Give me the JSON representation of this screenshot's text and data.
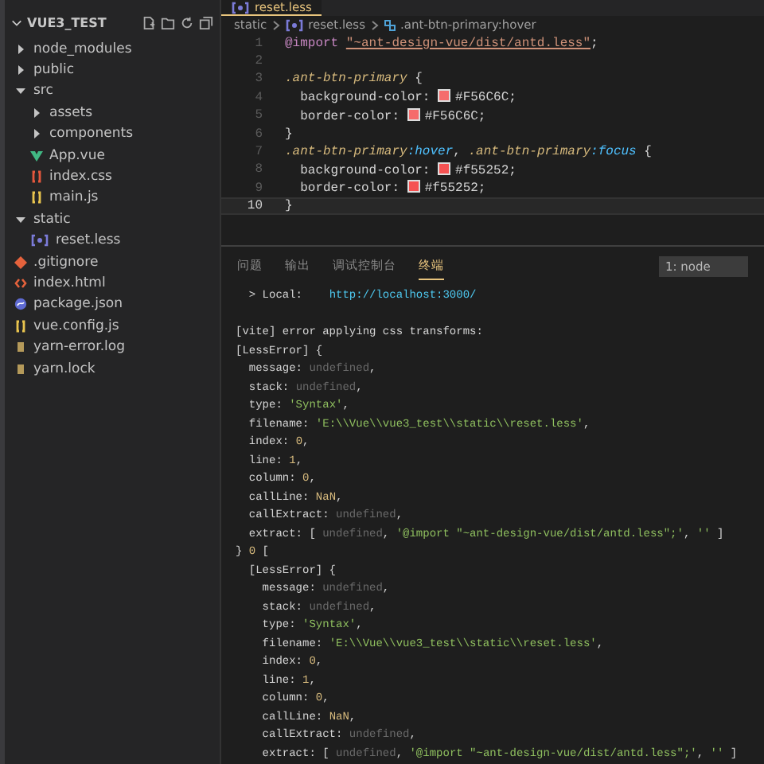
{
  "editor_tabs": [
    {
      "label": "reset.less",
      "selected": true,
      "kind": "less"
    }
  ],
  "explorer": {
    "title": "VUE3_TEST",
    "tree": [
      {
        "label": "node_modules",
        "kind": "folder",
        "expanded": false
      },
      {
        "label": "public",
        "kind": "folder",
        "expanded": false
      },
      {
        "label": "src",
        "kind": "folder",
        "expanded": true,
        "children": [
          {
            "label": "assets",
            "kind": "folder",
            "expanded": false
          },
          {
            "label": "components",
            "kind": "folder",
            "expanded": false
          },
          {
            "label": "App.vue",
            "kind": "vue"
          },
          {
            "label": "index.css",
            "kind": "css"
          },
          {
            "label": "main.js",
            "kind": "js"
          }
        ]
      },
      {
        "label": "static",
        "kind": "folder",
        "expanded": true,
        "children": [
          {
            "label": "reset.less",
            "kind": "less"
          }
        ]
      },
      {
        "label": ".gitignore",
        "kind": "git"
      },
      {
        "label": "index.html",
        "kind": "html"
      },
      {
        "label": "package.json",
        "kind": "json"
      },
      {
        "label": "vue.config.js",
        "kind": "js"
      },
      {
        "label": "yarn-error.log",
        "kind": "log"
      },
      {
        "label": "yarn.lock",
        "kind": "log"
      }
    ]
  },
  "breadcrumb": [
    {
      "label": "static",
      "kind": "plain"
    },
    {
      "label": "reset.less",
      "kind": "less"
    },
    {
      "label": ".ant-btn-primary:hover",
      "kind": "selector"
    }
  ],
  "code": [
    {
      "number": "1",
      "current": false,
      "tokens": [
        {
          "kind": "keyword",
          "text": "@import"
        },
        {
          "kind": "string",
          "text": "\"~ant-design-vue/dist/antd.less\""
        },
        {
          "kind": "plain",
          "text": ";"
        }
      ]
    },
    {
      "number": "2",
      "current": false
    },
    {
      "number": "3",
      "current": false,
      "tokens": [
        {
          "kind": "selector",
          "text": ".ant-btn-primary"
        },
        {
          "kind": "plain",
          "text": " {"
        }
      ]
    },
    {
      "number": "4",
      "current": false,
      "tokens": [
        {
          "kind": "plain",
          "text": "  background-color: "
        },
        {
          "kind": "color",
          "color": "#f56c6c",
          "text": "#F56C6C"
        },
        {
          "kind": "plain",
          "text": ";"
        }
      ]
    },
    {
      "number": "5",
      "current": false,
      "tokens": [
        {
          "kind": "plain",
          "text": "  border-color: "
        },
        {
          "kind": "color",
          "color": "#f56c6c",
          "text": "#F56C6C"
        },
        {
          "kind": "plain",
          "text": ";"
        }
      ]
    },
    {
      "number": "6",
      "current": false,
      "tokens": [
        {
          "kind": "plain",
          "text": "}"
        }
      ]
    },
    {
      "number": "7",
      "current": false,
      "tokens": [
        {
          "kind": "selector",
          "text": ".ant-btn-primary"
        },
        {
          "kind": "pseudo",
          "text": ":hover"
        },
        {
          "kind": "plain",
          "text": ", "
        },
        {
          "kind": "selector",
          "text": ".ant-btn-primary"
        },
        {
          "kind": "pseudo",
          "text": ":focus"
        },
        {
          "kind": "plain",
          "text": " {"
        }
      ]
    },
    {
      "number": "8",
      "current": false,
      "tokens": [
        {
          "kind": "plain",
          "text": "  background-color: "
        },
        {
          "kind": "color",
          "color": "#f55252",
          "text": "#f55252"
        },
        {
          "kind": "plain",
          "text": ";"
        }
      ]
    },
    {
      "number": "9",
      "current": false,
      "tokens": [
        {
          "kind": "plain",
          "text": "  border-color: "
        },
        {
          "kind": "color",
          "color": "#f55252",
          "text": "#f55252"
        },
        {
          "kind": "plain",
          "text": ";"
        }
      ]
    },
    {
      "number": "10",
      "current": true,
      "tokens": [
        {
          "kind": "plain",
          "text": "}"
        }
      ]
    }
  ],
  "panel_tabs": [
    {
      "label": "问题",
      "selected": false
    },
    {
      "label": "输出",
      "selected": false
    },
    {
      "label": "调试控制台",
      "selected": false
    },
    {
      "label": "终端",
      "selected": true
    }
  ],
  "terminal_select": "1: node",
  "terminal": [
    {
      "tokens": [
        {
          "kind": "plain",
          "text": "  > Local:    "
        },
        {
          "kind": "link",
          "text": "http://localhost:3000/"
        }
      ]
    },
    {
      "tokens": [
        {
          "kind": "plain",
          "text": "[vite] error applying css transforms:"
        }
      ]
    },
    {
      "tokens": [
        {
          "kind": "plain",
          "text": "[LessError] {"
        }
      ]
    },
    {
      "tokens": [
        {
          "kind": "plain",
          "text": "  message: "
        },
        {
          "kind": "dim",
          "text": "undefined"
        },
        {
          "kind": "plain",
          "text": ","
        }
      ]
    },
    {
      "tokens": [
        {
          "kind": "plain",
          "text": "  stack: "
        },
        {
          "kind": "dim",
          "text": "undefined"
        },
        {
          "kind": "plain",
          "text": ","
        }
      ]
    },
    {
      "tokens": [
        {
          "kind": "plain",
          "text": "  type: "
        },
        {
          "kind": "string",
          "text": "'Syntax'"
        },
        {
          "kind": "plain",
          "text": ","
        }
      ]
    },
    {
      "tokens": [
        {
          "kind": "plain",
          "text": "  filename: "
        },
        {
          "kind": "string",
          "text": "'E:\\\\Vue\\\\vue3_test\\\\static\\\\reset.less'"
        },
        {
          "kind": "plain",
          "text": ","
        }
      ]
    },
    {
      "tokens": [
        {
          "kind": "plain",
          "text": "  index: "
        },
        {
          "kind": "number",
          "text": "0"
        },
        {
          "kind": "plain",
          "text": ","
        }
      ]
    },
    {
      "tokens": [
        {
          "kind": "plain",
          "text": "  line: "
        },
        {
          "kind": "number",
          "text": "1"
        },
        {
          "kind": "plain",
          "text": ","
        }
      ]
    },
    {
      "tokens": [
        {
          "kind": "plain",
          "text": "  column: "
        },
        {
          "kind": "number",
          "text": "0"
        },
        {
          "kind": "plain",
          "text": ","
        }
      ]
    },
    {
      "tokens": [
        {
          "kind": "plain",
          "text": "  callLine: "
        },
        {
          "kind": "number",
          "text": "NaN"
        },
        {
          "kind": "plain",
          "text": ","
        }
      ]
    },
    {
      "tokens": [
        {
          "kind": "plain",
          "text": "  callExtract: "
        },
        {
          "kind": "dim",
          "text": "undefined"
        },
        {
          "kind": "plain",
          "text": ","
        }
      ]
    },
    {
      "tokens": [
        {
          "kind": "plain",
          "text": "  extract: [ "
        },
        {
          "kind": "dim",
          "text": "undefined"
        },
        {
          "kind": "plain",
          "text": ", "
        },
        {
          "kind": "string",
          "text": "'@import \"~ant-design-vue/dist/antd.less\";'"
        },
        {
          "kind": "plain",
          "text": ", "
        },
        {
          "kind": "string",
          "text": "''"
        },
        {
          "kind": "plain",
          "text": " ]"
        }
      ]
    },
    {
      "tokens": [
        {
          "kind": "plain",
          "text": "} "
        },
        {
          "kind": "number",
          "text": "0"
        },
        {
          "kind": "plain",
          "text": " ["
        }
      ]
    },
    {
      "tokens": [
        {
          "kind": "plain",
          "text": "  [LessError] {"
        }
      ]
    },
    {
      "tokens": [
        {
          "kind": "plain",
          "text": "    message: "
        },
        {
          "kind": "dim",
          "text": "undefined"
        },
        {
          "kind": "plain",
          "text": ","
        }
      ]
    },
    {
      "tokens": [
        {
          "kind": "plain",
          "text": "    stack: "
        },
        {
          "kind": "dim",
          "text": "undefined"
        },
        {
          "kind": "plain",
          "text": ","
        }
      ]
    },
    {
      "tokens": [
        {
          "kind": "plain",
          "text": "    type: "
        },
        {
          "kind": "string",
          "text": "'Syntax'"
        },
        {
          "kind": "plain",
          "text": ","
        }
      ]
    },
    {
      "tokens": [
        {
          "kind": "plain",
          "text": "    filename: "
        },
        {
          "kind": "string",
          "text": "'E:\\\\Vue\\\\vue3_test\\\\static\\\\reset.less'"
        },
        {
          "kind": "plain",
          "text": ","
        }
      ]
    },
    {
      "tokens": [
        {
          "kind": "plain",
          "text": "    index: "
        },
        {
          "kind": "number",
          "text": "0"
        },
        {
          "kind": "plain",
          "text": ","
        }
      ]
    },
    {
      "tokens": [
        {
          "kind": "plain",
          "text": "    line: "
        },
        {
          "kind": "number",
          "text": "1"
        },
        {
          "kind": "plain",
          "text": ","
        }
      ]
    },
    {
      "tokens": [
        {
          "kind": "plain",
          "text": "    column: "
        },
        {
          "kind": "number",
          "text": "0"
        },
        {
          "kind": "plain",
          "text": ","
        }
      ]
    },
    {
      "tokens": [
        {
          "kind": "plain",
          "text": "    callLine: "
        },
        {
          "kind": "number",
          "text": "NaN"
        },
        {
          "kind": "plain",
          "text": ","
        }
      ]
    },
    {
      "tokens": [
        {
          "kind": "plain",
          "text": "    callExtract: "
        },
        {
          "kind": "dim",
          "text": "undefined"
        },
        {
          "kind": "plain",
          "text": ","
        }
      ]
    },
    {
      "tokens": [
        {
          "kind": "plain",
          "text": "    extract: [ "
        },
        {
          "kind": "dim",
          "text": "undefined"
        },
        {
          "kind": "plain",
          "text": ", "
        },
        {
          "kind": "string",
          "text": "'@import \"~ant-design-vue/dist/antd.less\";'"
        },
        {
          "kind": "plain",
          "text": ", "
        },
        {
          "kind": "string",
          "text": "''"
        },
        {
          "kind": "plain",
          "text": " ]"
        }
      ]
    }
  ]
}
